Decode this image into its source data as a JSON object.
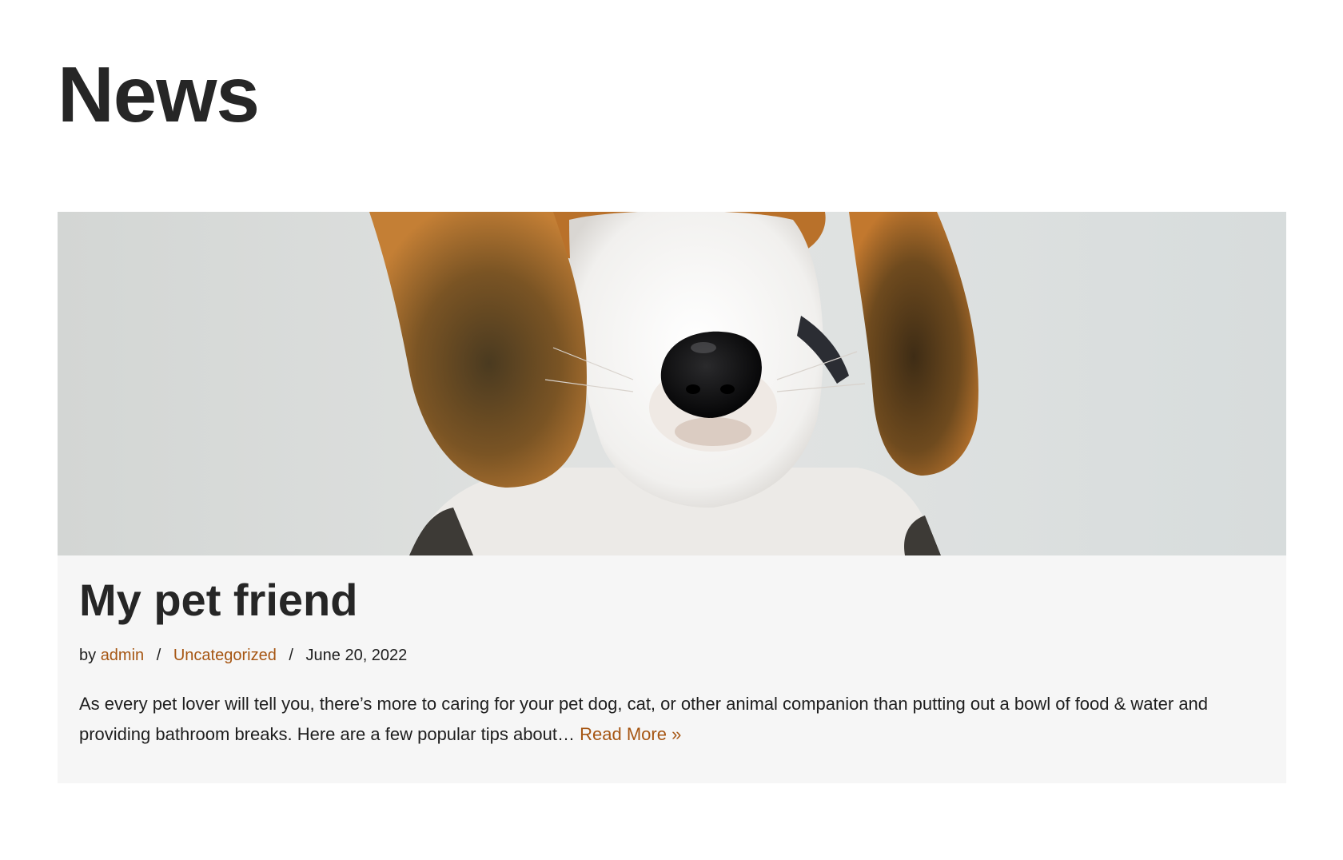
{
  "page": {
    "title": "News"
  },
  "post": {
    "image_subject": "beagle-puppy-photo",
    "title": "My pet friend",
    "meta": {
      "by_label": "by",
      "author": "admin",
      "separator": "/",
      "category": "Uncategorized",
      "date": "June 20, 2022"
    },
    "excerpt": "As every pet lover will tell you, there’s more to caring for your pet dog, cat, or other animal companion than putting out a bowl of food & water and providing bathroom breaks. Here are a few popular tips about…",
    "read_more": "Read More »"
  },
  "colors": {
    "link": "#a65613",
    "heading": "#262626",
    "card_background": "#f6f6f6"
  }
}
